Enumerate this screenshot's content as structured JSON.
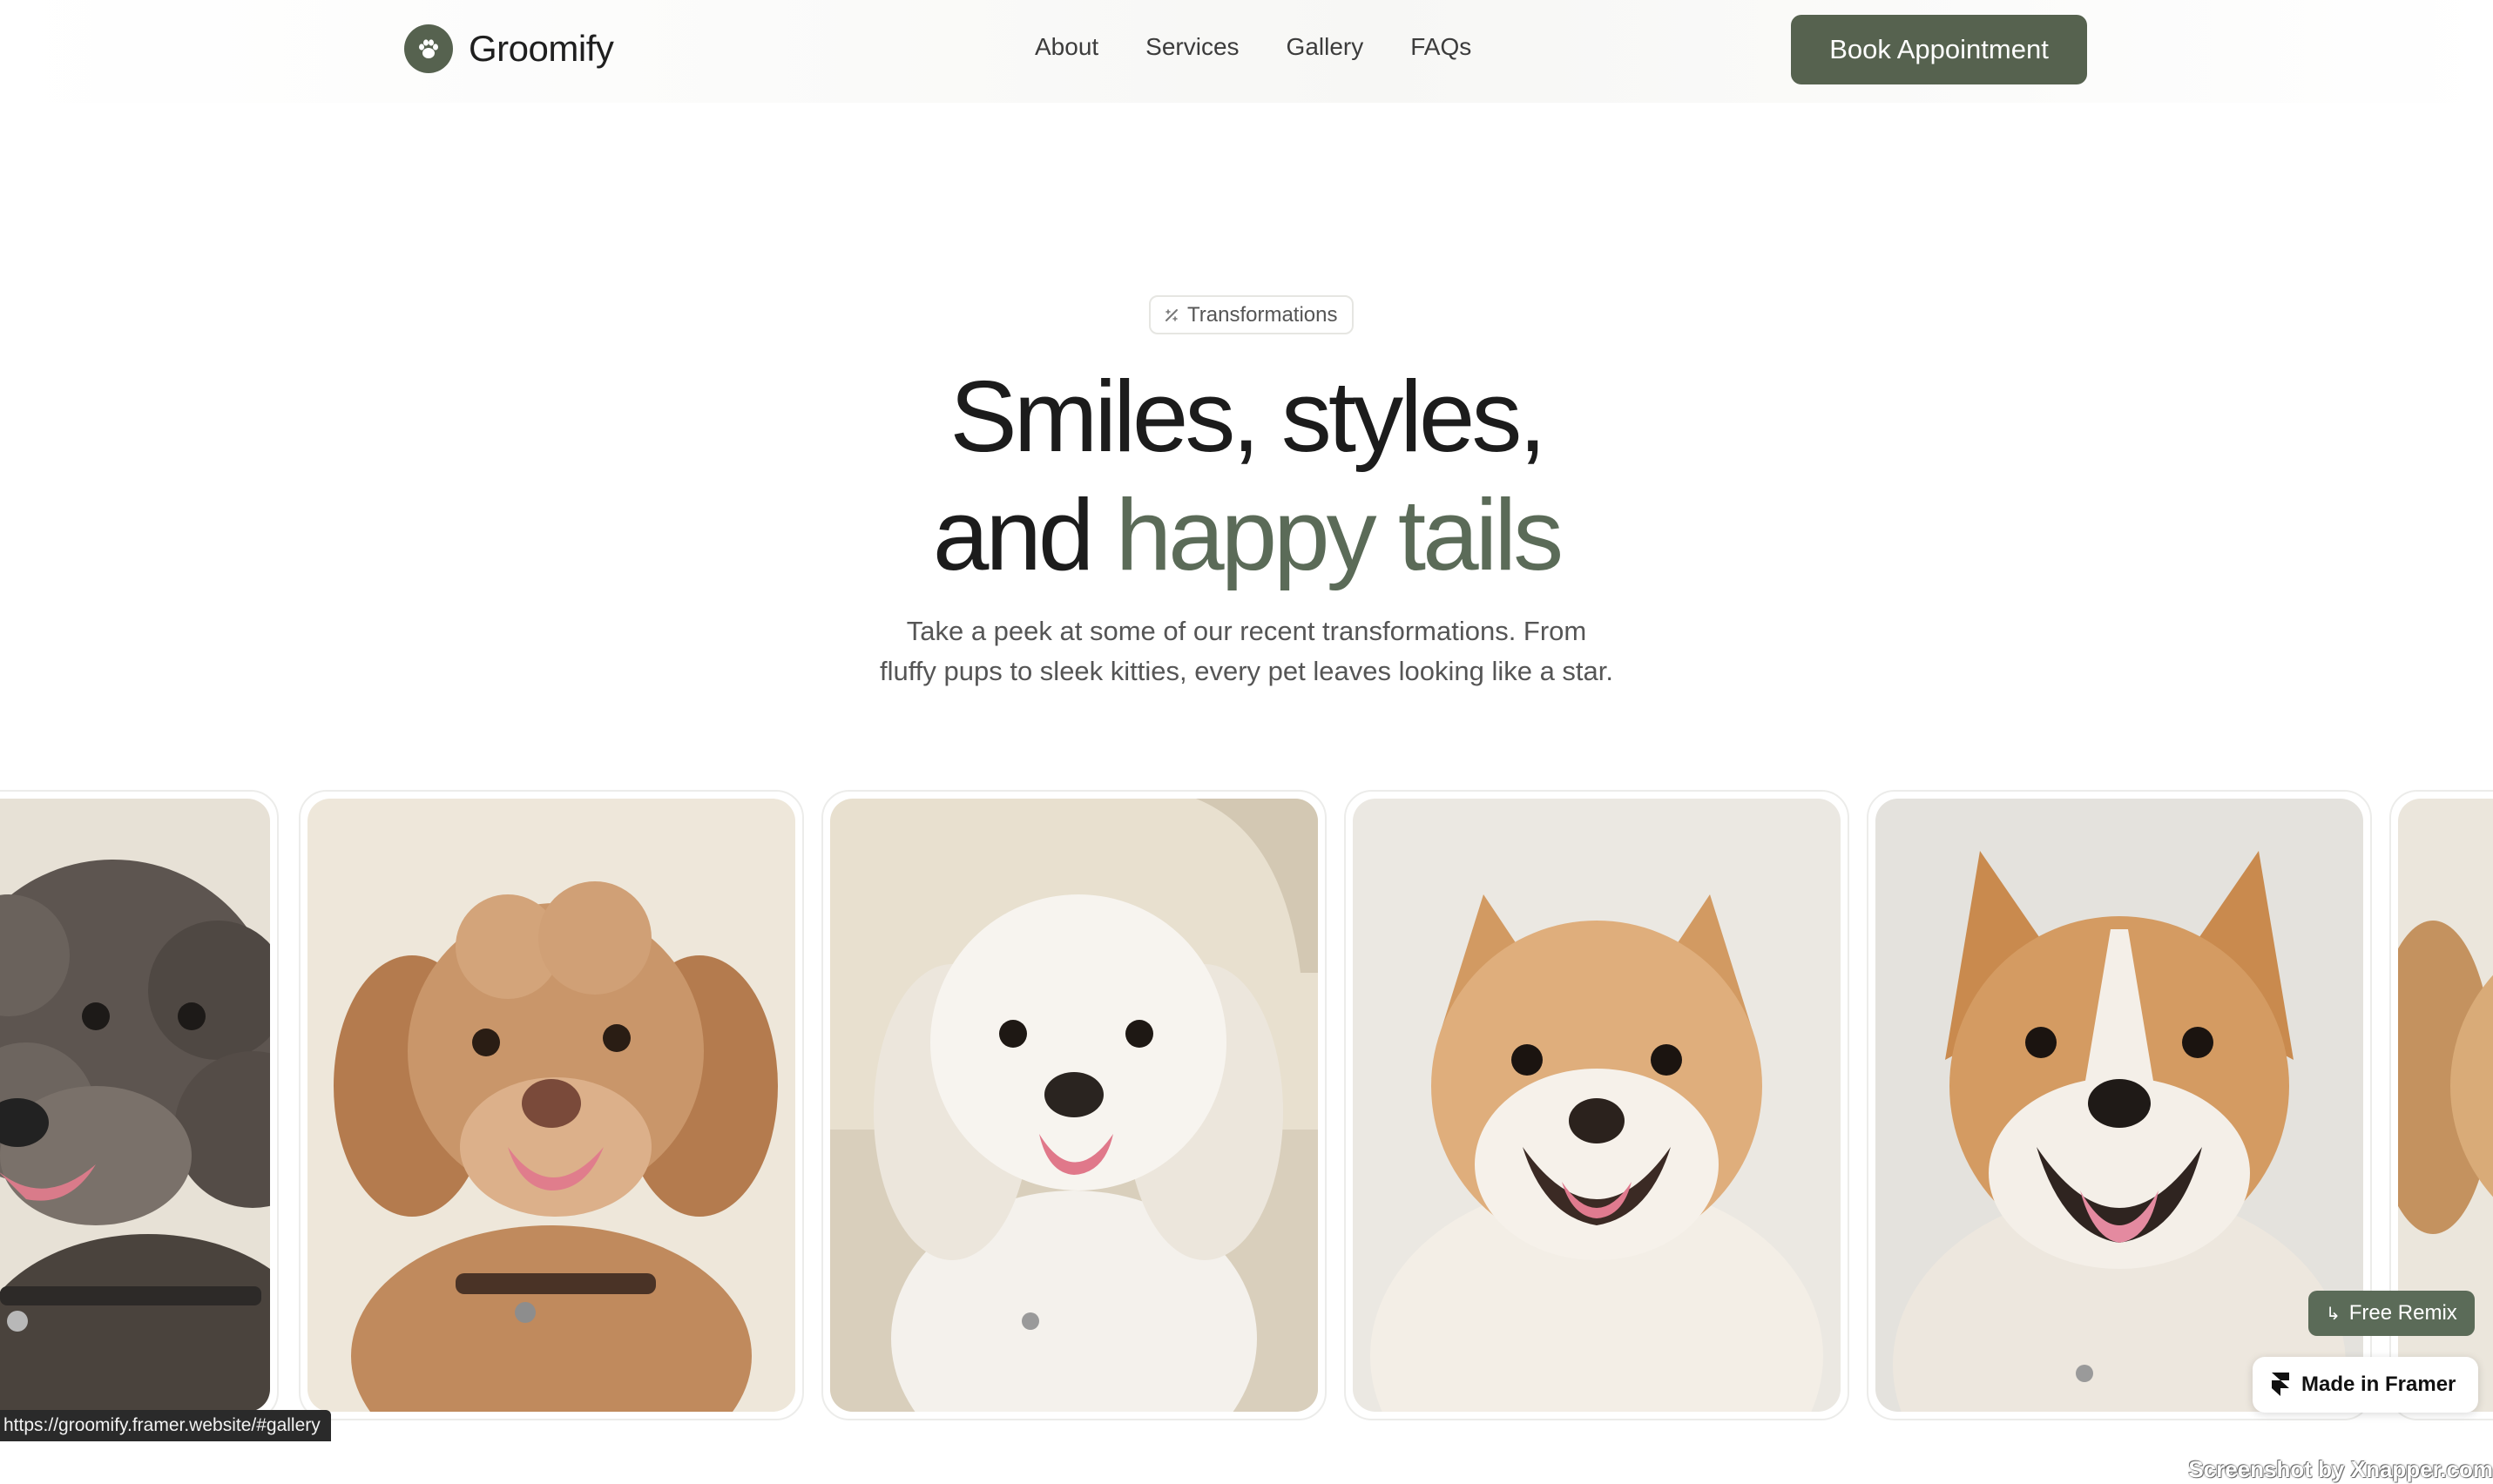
{
  "header": {
    "brand": "Groomify",
    "logo_icon": "paw-icon",
    "nav": [
      {
        "label": "About"
      },
      {
        "label": "Services"
      },
      {
        "label": "Gallery"
      },
      {
        "label": "FAQs"
      }
    ],
    "cta_label": "Book Appointment"
  },
  "hero": {
    "badge_icon": "sparkle-icon",
    "badge": "Transformations",
    "title_line1": "Smiles, styles,",
    "title_line2_prefix": "and ",
    "title_line2_accent": "happy tails",
    "subtitle_line1": "Take a peek at some of our recent transformations. From",
    "subtitle_line2": "fluffy pups to sleek kitties, every pet leaves looking like a star."
  },
  "gallery": {
    "cards": [
      {
        "name": "gallery-card-dark-poodle"
      },
      {
        "name": "gallery-card-apricot-poodle"
      },
      {
        "name": "gallery-card-white-maltese"
      },
      {
        "name": "gallery-card-pomeranian"
      },
      {
        "name": "gallery-card-corgi-mix"
      },
      {
        "name": "gallery-card-partial"
      }
    ]
  },
  "overlays": {
    "status_url": "https://groomify.framer.website/#gallery",
    "free_remix": "Free Remix",
    "made_in_framer": "Made in Framer",
    "watermark": "Screenshot by Xnapper.com"
  },
  "colors": {
    "accent": "#56624f",
    "accent_text": "#5b6b58",
    "text": "#1c1c1c"
  }
}
